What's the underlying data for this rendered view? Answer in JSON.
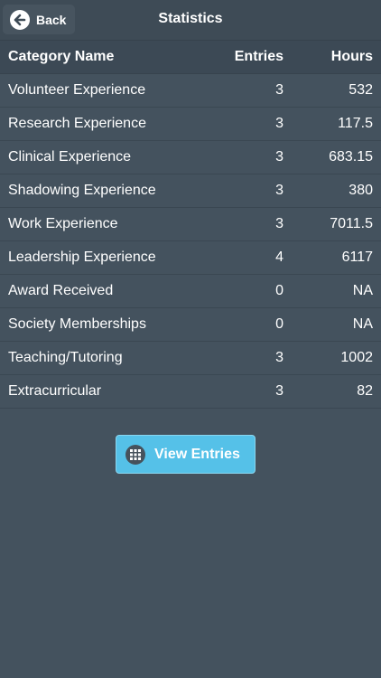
{
  "nav": {
    "back_label": "Back",
    "title": "Statistics"
  },
  "table": {
    "headers": {
      "name": "Category Name",
      "entries": "Entries",
      "hours": "Hours"
    },
    "rows": [
      {
        "name": "Volunteer Experience",
        "entries": "3",
        "hours": "532"
      },
      {
        "name": "Research Experience",
        "entries": "3",
        "hours": "117.5"
      },
      {
        "name": "Clinical Experience",
        "entries": "3",
        "hours": "683.15"
      },
      {
        "name": "Shadowing Experience",
        "entries": "3",
        "hours": "380"
      },
      {
        "name": "Work Experience",
        "entries": "3",
        "hours": "7011.5"
      },
      {
        "name": "Leadership Experience",
        "entries": "4",
        "hours": "6117"
      },
      {
        "name": "Award Received",
        "entries": "0",
        "hours": "NA"
      },
      {
        "name": "Society Memberships",
        "entries": "0",
        "hours": "NA"
      },
      {
        "name": "Teaching/Tutoring",
        "entries": "3",
        "hours": "1002"
      },
      {
        "name": "Extracurricular",
        "entries": "3",
        "hours": "82"
      }
    ]
  },
  "actions": {
    "view_entries_label": "View Entries"
  },
  "icons": {
    "back": "arrow-left-icon",
    "view_entries": "grid-icon"
  },
  "colors": {
    "background": "#44525e",
    "accent": "#55c1e8"
  }
}
